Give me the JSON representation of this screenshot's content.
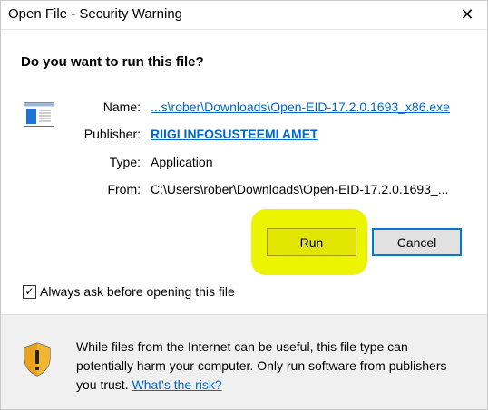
{
  "window": {
    "title": "Open File - Security Warning",
    "close_glyph": "✕"
  },
  "heading": "Do you want to run this file?",
  "fields": {
    "name_label": "Name:",
    "name_value": "...s\\rober\\Downloads\\Open-EID-17.2.0.1693_x86.exe",
    "publisher_label": "Publisher:",
    "publisher_value": "RIIGI INFOSUSTEEMI AMET",
    "type_label": "Type:",
    "type_value": "Application",
    "from_label": "From:",
    "from_value": "C:\\Users\\rober\\Downloads\\Open-EID-17.2.0.1693_..."
  },
  "buttons": {
    "run": "Run",
    "cancel": "Cancel"
  },
  "checkbox": {
    "label": "Always ask before opening this file",
    "checked": true,
    "glyph": "✓"
  },
  "warning": {
    "text": "While files from the Internet can be useful, this file type can potentially harm your computer. Only run software from publishers you trust.",
    "link": "What's the risk?"
  },
  "colors": {
    "highlight": "#ecf400",
    "link": "#0066cc",
    "focus_border": "#0078d7"
  },
  "icons": {
    "file": "application-file-icon",
    "shield": "security-shield-icon",
    "close": "close-icon"
  }
}
